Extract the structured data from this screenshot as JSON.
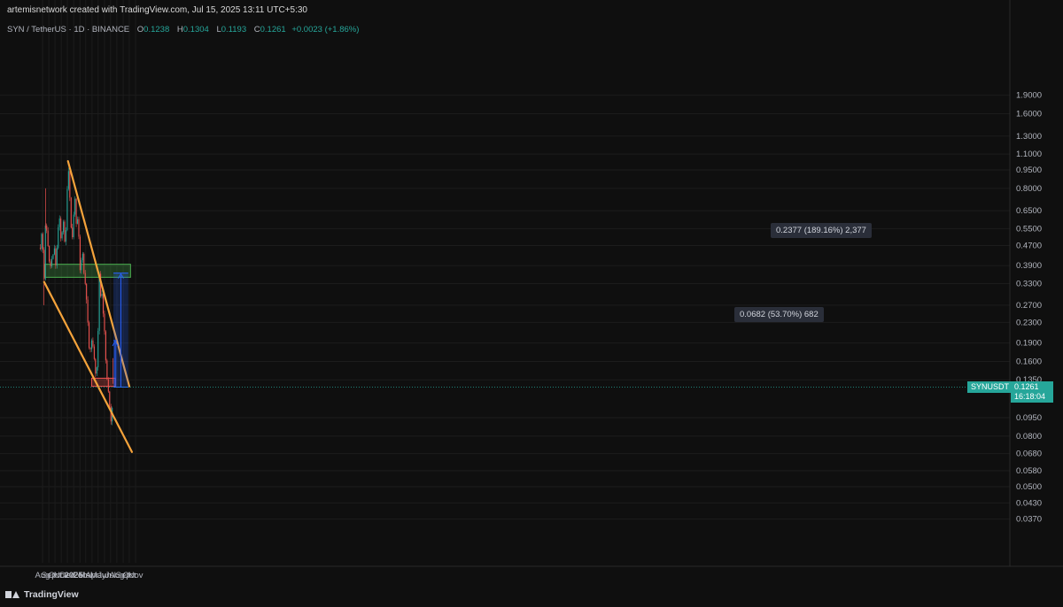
{
  "header": {
    "credit": "artemisnetwork created with TradingView.com, Jul 15, 2025 13:11 UTC+5:30"
  },
  "symbol": {
    "name": "SYN / TetherUS · 1D · BINANCE",
    "open_label": "O",
    "open": "0.1238",
    "high_label": "H",
    "high": "0.1304",
    "low_label": "L",
    "low": "0.1193",
    "close_label": "C",
    "close": "0.1261",
    "change": "+0.0023 (+1.86%)"
  },
  "price_axis": {
    "ticks": [
      "1.9000",
      "1.6000",
      "1.3000",
      "1.1000",
      "0.9500",
      "0.8000",
      "0.6500",
      "0.5500",
      "0.4700",
      "0.3900",
      "0.3300",
      "0.2700",
      "0.2300",
      "0.1900",
      "0.1600",
      "0.1350",
      "0.0950",
      "0.0800",
      "0.0680",
      "0.0580",
      "0.0500",
      "0.0430",
      "0.0370"
    ]
  },
  "time_axis": {
    "ticks": [
      "Aug",
      "Sep",
      "Oct",
      "Nov",
      "Dec",
      "2025",
      "Feb",
      "Mar",
      "Apr",
      "May",
      "Jun",
      "Jul",
      "Aug",
      "Sep",
      "Oct",
      "Nov"
    ]
  },
  "last_price": {
    "symbol": "SYNUSDT",
    "price": "0.1261",
    "countdown": "16:18:04"
  },
  "measurements": {
    "upper": "0.2377 (189.16%) 2,377",
    "lower": "0.0682 (53.70%) 682"
  },
  "footer": {
    "brand": "TradingView"
  },
  "colors": {
    "background": "#0f0f0f",
    "up": "#26a69a",
    "down": "#ef5350",
    "trendline": "#f5a33b",
    "resistance_zone": "#4caf50",
    "support_zone": "#ef5350",
    "target_box": "#2962ff"
  },
  "chart_data": {
    "type": "candlestick",
    "symbol": "SYN / TetherUS",
    "interval": "1D",
    "scale": "log",
    "ylim": [
      0.035,
      1.95
    ],
    "x_ticks": [
      "Aug",
      "Sep",
      "Oct",
      "Nov",
      "Dec",
      "2025",
      "Feb",
      "Mar",
      "Apr",
      "May",
      "Jun",
      "Jul",
      "Aug",
      "Sep",
      "Oct",
      "Nov"
    ],
    "y_ticks": [
      1.9,
      1.6,
      1.3,
      1.1,
      0.95,
      0.8,
      0.65,
      0.55,
      0.47,
      0.39,
      0.33,
      0.27,
      0.23,
      0.19,
      0.16,
      0.135,
      0.095,
      0.08,
      0.068,
      0.058,
      0.05,
      0.043,
      0.037
    ],
    "price_path": [
      {
        "t": "2024-07-21",
        "p": 0.46
      },
      {
        "t": "2024-07-28",
        "p": 0.52
      },
      {
        "t": "2024-08-03",
        "p": 0.44
      },
      {
        "t": "2024-08-07",
        "p": 0.33
      },
      {
        "t": "2024-08-12",
        "p": 0.36
      },
      {
        "t": "2024-08-16",
        "p": 0.65
      },
      {
        "t": "2024-08-22",
        "p": 0.53
      },
      {
        "t": "2024-08-30",
        "p": 0.44
      },
      {
        "t": "2024-09-08",
        "p": 0.38
      },
      {
        "t": "2024-09-18",
        "p": 0.43
      },
      {
        "t": "2024-09-30",
        "p": 0.46
      },
      {
        "t": "2024-10-06",
        "p": 0.38
      },
      {
        "t": "2024-10-16",
        "p": 0.55
      },
      {
        "t": "2024-10-24",
        "p": 0.62
      },
      {
        "t": "2024-11-01",
        "p": 0.47
      },
      {
        "t": "2024-11-10",
        "p": 0.6
      },
      {
        "t": "2024-11-21",
        "p": 0.46
      },
      {
        "t": "2024-11-29",
        "p": 0.72
      },
      {
        "t": "2024-12-05",
        "p": 1.0
      },
      {
        "t": "2024-12-11",
        "p": 0.78
      },
      {
        "t": "2024-12-19",
        "p": 0.56
      },
      {
        "t": "2024-12-26",
        "p": 0.5
      },
      {
        "t": "2025-01-02",
        "p": 0.66
      },
      {
        "t": "2025-01-08",
        "p": 0.72
      },
      {
        "t": "2025-01-14",
        "p": 0.58
      },
      {
        "t": "2025-01-22",
        "p": 0.62
      },
      {
        "t": "2025-01-30",
        "p": 0.44
      },
      {
        "t": "2025-02-04",
        "p": 0.32
      },
      {
        "t": "2025-02-10",
        "p": 0.48
      },
      {
        "t": "2025-02-18",
        "p": 0.38
      },
      {
        "t": "2025-02-28",
        "p": 0.32
      },
      {
        "t": "2025-03-06",
        "p": 0.27
      },
      {
        "t": "2025-03-12",
        "p": 0.23
      },
      {
        "t": "2025-03-19",
        "p": 0.17
      },
      {
        "t": "2025-03-26",
        "p": 0.19
      },
      {
        "t": "2025-04-05",
        "p": 0.19
      },
      {
        "t": "2025-04-12",
        "p": 0.16
      },
      {
        "t": "2025-04-18",
        "p": 0.14
      },
      {
        "t": "2025-04-25",
        "p": 0.15
      },
      {
        "t": "2025-05-01",
        "p": 0.22
      },
      {
        "t": "2025-05-07",
        "p": 0.36
      },
      {
        "t": "2025-05-13",
        "p": 0.29
      },
      {
        "t": "2025-05-18",
        "p": 0.32
      },
      {
        "t": "2025-05-23",
        "p": 0.25
      },
      {
        "t": "2025-05-30",
        "p": 0.24
      },
      {
        "t": "2025-06-06",
        "p": 0.17
      },
      {
        "t": "2025-06-12",
        "p": 0.14
      },
      {
        "t": "2025-06-18",
        "p": 0.13
      },
      {
        "t": "2025-06-24",
        "p": 0.11
      },
      {
        "t": "2025-06-30",
        "p": 0.095
      },
      {
        "t": "2025-07-06",
        "p": 0.085
      },
      {
        "t": "2025-07-10",
        "p": 0.11
      },
      {
        "t": "2025-07-15",
        "p": 0.1261
      }
    ],
    "trendlines": [
      {
        "name": "upper",
        "from": {
          "t": "2024-12-04",
          "p": 1.03
        },
        "to": {
          "t": "2025-10-01",
          "p": 0.127
        }
      },
      {
        "name": "lower",
        "from": {
          "t": "2024-08-09",
          "p": 0.335
        },
        "to": {
          "t": "2025-10-14",
          "p": 0.069
        }
      }
    ],
    "zones": [
      {
        "name": "resistance",
        "t_from": "2024-08-12",
        "t_to": "2025-10-07",
        "p_low": 0.35,
        "p_high": 0.395
      },
      {
        "name": "support",
        "t_from": "2025-03-30",
        "t_to": "2025-07-25",
        "p_low": 0.127,
        "p_high": 0.137
      }
    ],
    "targets": [
      {
        "label": "0.0682 (53.70%) 682",
        "t_from": "2025-07-15",
        "t_to": "2025-08-01",
        "p_low": 0.1261,
        "p_high": 0.1943
      },
      {
        "label": "0.2377 (189.16%) 2,377",
        "t_from": "2025-07-15",
        "t_to": "2025-09-26",
        "p_low": 0.1261,
        "p_high": 0.3638
      }
    ],
    "last_price": 0.1261
  }
}
